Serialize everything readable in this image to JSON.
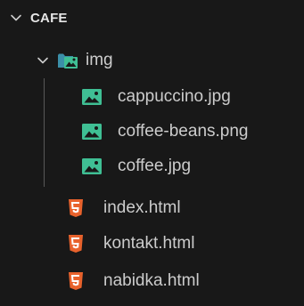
{
  "explorer": {
    "section_title": "CAFE",
    "folder": {
      "name": "img",
      "icon": "image-folder-icon",
      "expanded": true
    },
    "children": [
      {
        "name": "cappuccino.jpg",
        "icon": "image-file-icon"
      },
      {
        "name": "coffee-beans.png",
        "icon": "image-file-icon"
      },
      {
        "name": "coffee.jpg",
        "icon": "image-file-icon"
      }
    ],
    "files": [
      {
        "name": "index.html",
        "icon": "html5-icon"
      },
      {
        "name": "kontakt.html",
        "icon": "html5-icon"
      },
      {
        "name": "nabidka.html",
        "icon": "html5-icon"
      }
    ],
    "colors": {
      "background": "#181818",
      "text": "#cccccc",
      "image_icon": "#3fbf94",
      "html_icon": "#e8622c",
      "folder_icon": "#3fa9c9"
    }
  }
}
